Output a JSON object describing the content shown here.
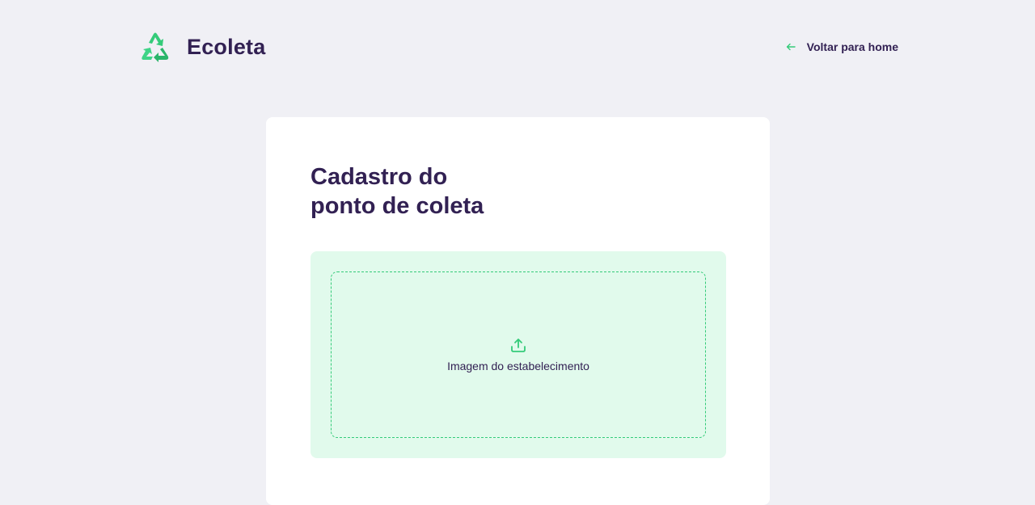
{
  "header": {
    "brand": "Ecoleta",
    "logo_icon": "recycle-icon",
    "back_link": {
      "icon": "arrow-left-icon",
      "label": "Voltar para home"
    }
  },
  "form": {
    "title_line1": "Cadastro do",
    "title_line2": "ponto de coleta",
    "dropzone": {
      "icon": "upload-icon",
      "label": "Imagem do estabelecimento"
    }
  },
  "colors": {
    "background": "#F0F0F5",
    "card": "#FFFFFF",
    "title": "#322153",
    "accent": "#34CB79",
    "dropzone_bg": "#E1FAEC"
  }
}
